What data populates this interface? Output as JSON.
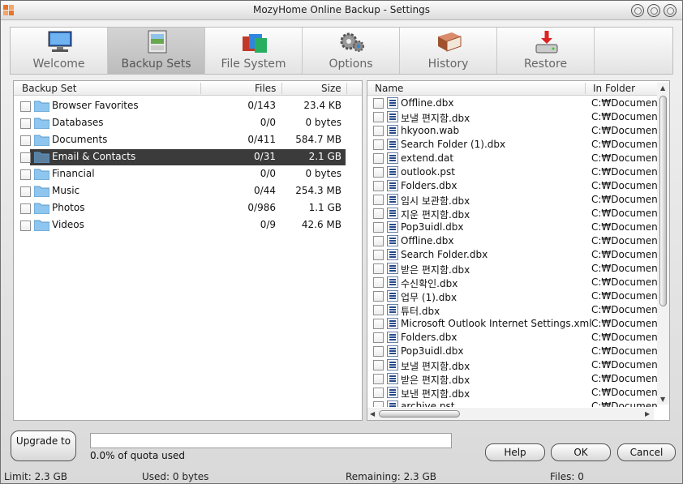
{
  "window": {
    "title": "MozyHome Online Backup - Settings"
  },
  "tabs": [
    {
      "label": "Welcome",
      "icon": "monitor-icon"
    },
    {
      "label": "Backup Sets",
      "icon": "photos-icon"
    },
    {
      "label": "File System",
      "icon": "folders-icon"
    },
    {
      "label": "Options",
      "icon": "gears-icon"
    },
    {
      "label": "History",
      "icon": "book-icon"
    },
    {
      "label": "Restore",
      "icon": "restore-drive-icon"
    }
  ],
  "active_tab": "Backup Sets",
  "backup_sets": {
    "columns": [
      "Backup Set",
      "Files",
      "Size"
    ],
    "rows": [
      {
        "name": "Browser Favorites",
        "files": "0/143",
        "size": "23.4 KB"
      },
      {
        "name": "Databases",
        "files": "0/0",
        "size": "0 bytes"
      },
      {
        "name": "Documents",
        "files": "0/411",
        "size": "584.7 MB"
      },
      {
        "name": "Email & Contacts",
        "files": "0/31",
        "size": "2.1 GB"
      },
      {
        "name": "Financial",
        "files": "0/0",
        "size": "0 bytes"
      },
      {
        "name": "Music",
        "files": "0/44",
        "size": "254.3 MB"
      },
      {
        "name": "Photos",
        "files": "0/986",
        "size": "1.1 GB"
      },
      {
        "name": "Videos",
        "files": "0/9",
        "size": "42.6 MB"
      }
    ],
    "selected": "Email & Contacts"
  },
  "files": {
    "columns": [
      "Name",
      "In Folder"
    ],
    "rows": [
      {
        "name": "Offline.dbx",
        "folder": "C:₩Documents"
      },
      {
        "name": "보낼 편지함.dbx",
        "folder": "C:₩Documents"
      },
      {
        "name": "hkyoon.wab",
        "folder": "C:₩Documents"
      },
      {
        "name": "Search Folder (1).dbx",
        "folder": "C:₩Documents"
      },
      {
        "name": "extend.dat",
        "folder": "C:₩Documents"
      },
      {
        "name": "outlook.pst",
        "folder": "C:₩Documents"
      },
      {
        "name": "Folders.dbx",
        "folder": "C:₩Documents"
      },
      {
        "name": "임시 보관함.dbx",
        "folder": "C:₩Documents"
      },
      {
        "name": "지운 편지함.dbx",
        "folder": "C:₩Documents"
      },
      {
        "name": "Pop3uidl.dbx",
        "folder": "C:₩Documents"
      },
      {
        "name": "Offline.dbx",
        "folder": "C:₩Documents"
      },
      {
        "name": "Search Folder.dbx",
        "folder": "C:₩Documents"
      },
      {
        "name": "받은 편지함.dbx",
        "folder": "C:₩Documents"
      },
      {
        "name": "수신확인.dbx",
        "folder": "C:₩Documents"
      },
      {
        "name": "업무 (1).dbx",
        "folder": "C:₩Documents"
      },
      {
        "name": "튜터.dbx",
        "folder": "C:₩Documents"
      },
      {
        "name": "Microsoft Outlook Internet Settings.xml",
        "folder": "C:₩Documents"
      },
      {
        "name": "Folders.dbx",
        "folder": "C:₩Documents"
      },
      {
        "name": "Pop3uidl.dbx",
        "folder": "C:₩Documents"
      },
      {
        "name": "보낼 편지함.dbx",
        "folder": "C:₩Documents"
      },
      {
        "name": "받은 편지함.dbx",
        "folder": "C:₩Documents"
      },
      {
        "name": "보낸 편지함.dbx",
        "folder": "C:₩Documents"
      },
      {
        "name": "archive.pst",
        "folder": "C:₩Documents"
      }
    ]
  },
  "bottom": {
    "upgrade_label": "Upgrade to",
    "quota_text": "0.0% of quota used",
    "quota_fraction": 0.0,
    "help_label": "Help",
    "ok_label": "OK",
    "cancel_label": "Cancel"
  },
  "status": {
    "limit": "Limit: 2.3 GB",
    "used": "Used: 0 bytes",
    "remaining": "Remaining: 2.3 GB",
    "files": "Files: 0"
  }
}
